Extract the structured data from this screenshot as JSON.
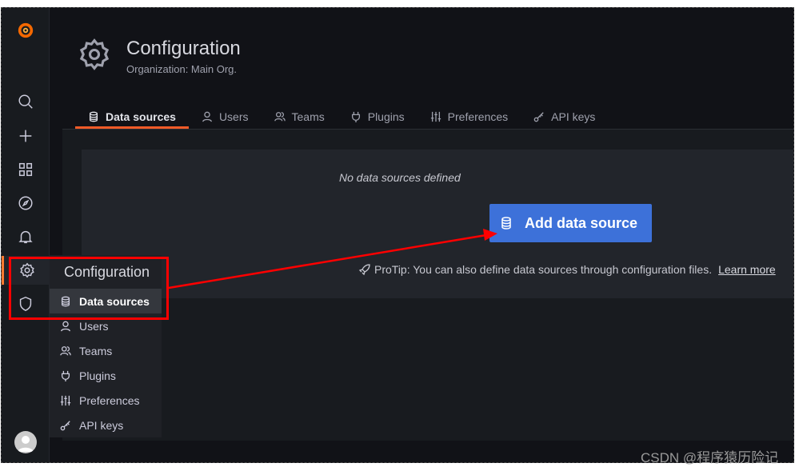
{
  "header": {
    "title": "Configuration",
    "subtitle": "Organization: Main Org."
  },
  "tabs": [
    {
      "label": "Data sources",
      "icon": "database-icon",
      "active": true
    },
    {
      "label": "Users",
      "icon": "user-icon"
    },
    {
      "label": "Teams",
      "icon": "users-icon"
    },
    {
      "label": "Plugins",
      "icon": "plug-icon"
    },
    {
      "label": "Preferences",
      "icon": "sliders-icon"
    },
    {
      "label": "API keys",
      "icon": "key-icon"
    }
  ],
  "main": {
    "empty_text": "No data sources defined",
    "add_button": "Add data source",
    "protip": "ProTip: You can also define data sources through configuration files.",
    "learn_more": "Learn more"
  },
  "menu": {
    "title": "Configuration",
    "items": [
      {
        "label": "Data sources",
        "active": true
      },
      {
        "label": "Users"
      },
      {
        "label": "Teams"
      },
      {
        "label": "Plugins"
      },
      {
        "label": "Preferences"
      },
      {
        "label": "API keys"
      }
    ]
  },
  "sidebar": {
    "icons": [
      "grafana-logo",
      "search-icon",
      "plus-icon",
      "dashboards-icon",
      "explore-icon",
      "bell-icon",
      "gear-icon",
      "shield-icon",
      "avatar"
    ]
  },
  "colors": {
    "accent": "#f05a28",
    "primary_button": "#3d71d9",
    "annotation": "#ff0000"
  },
  "watermark": "CSDN @程序猿历险记"
}
